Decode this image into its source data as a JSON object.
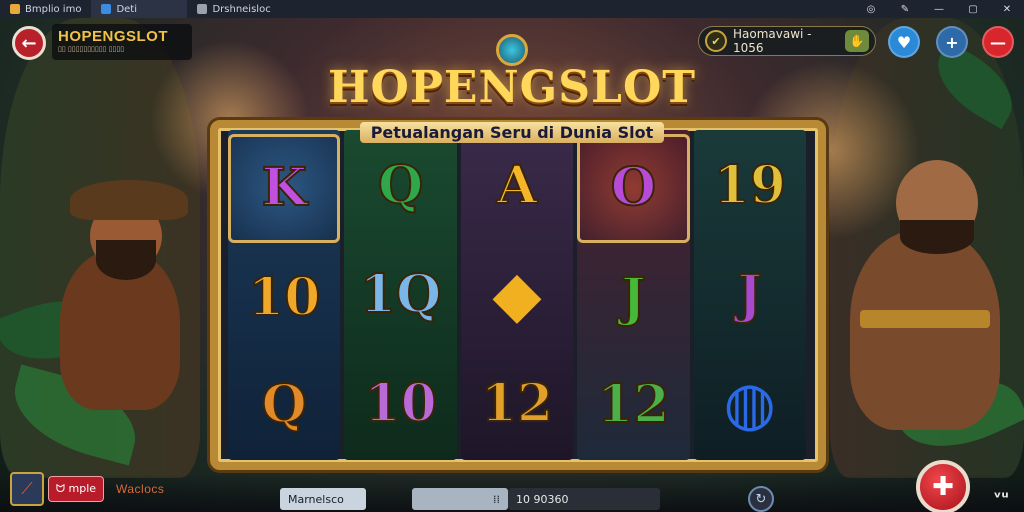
{
  "window": {
    "tabs": [
      {
        "label": "Bmplio imo",
        "icon": "app-icon"
      },
      {
        "label": "Deti",
        "icon": "chat-icon"
      },
      {
        "label": "Drshneisloc",
        "icon": "game-icon"
      }
    ],
    "controls": [
      "◎",
      "✎",
      "—",
      "▢",
      "✕"
    ]
  },
  "topbar": {
    "back_icon": "←",
    "brand_title": "HOPENGSLOT",
    "brand_subtitle": "▯▯ ▯▯▯▯▯▯▯▯▯▯ ▯▯▯▯",
    "balance_text": "Haomavawi - 1056",
    "balance_coin_icon": "✔",
    "hand_icon": "✋",
    "fav_icon": "♥",
    "add_icon": "+",
    "remove_icon": "—"
  },
  "game": {
    "title": "HOPENGSLOT",
    "subtitle": "Petualangan Seru di Dunia Slot"
  },
  "reels": [
    [
      "K",
      "10",
      "Q"
    ],
    [
      "Q",
      "1Q",
      "10"
    ],
    [
      "A",
      "◆",
      "12"
    ],
    [
      "O",
      "J",
      "12"
    ],
    [
      "19",
      "J",
      "◍"
    ]
  ],
  "colors": {
    "gold": "#ffd75a",
    "reel_k": "#c050e0",
    "reel_q": "#2ea84a",
    "reel_a": "#f5b52a",
    "reel_o": "#b84ad8",
    "reel_19": "#e0c03a",
    "reel_10": "#f0a82a",
    "reel_1q": "#7ab6e8",
    "reel_j": "#48b838",
    "reel_j2": "#a84ad0",
    "reel_12": "#4cb04a",
    "spin": "#d82a30"
  },
  "bottombar": {
    "chip_label": "ᗢ mple",
    "side_label": "Waclocs",
    "field1": "Marnelsco",
    "field2_icon": "⁞⁞",
    "field3": "10 90360",
    "refresh_icon": "↻",
    "spin_icon": "✚",
    "menu_icon": "ᵛᵘ"
  }
}
